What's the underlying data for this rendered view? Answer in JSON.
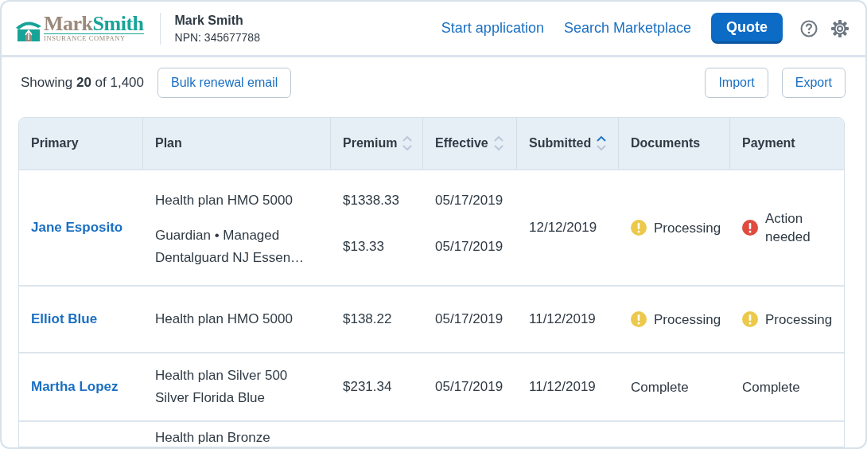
{
  "header": {
    "logo": {
      "first": "Mark",
      "second": "Smith",
      "tagline": "INSURANCE COMPANY"
    },
    "agent_name": "Mark Smith",
    "agent_npn": "NPN: 345677788",
    "links": [
      "Start application",
      "Search Marketplace"
    ],
    "primary_button": "Quote"
  },
  "toolbar": {
    "showing": "Showing **20** of 1,400",
    "bulk_button": "Bulk renewal email",
    "buttons": [
      "Import",
      "Export"
    ]
  },
  "table": {
    "columns": [
      {
        "label": "Primary",
        "kind": "plain"
      },
      {
        "label": "Plan",
        "kind": "plain"
      },
      {
        "label": "Premium",
        "kind": "sortable"
      },
      {
        "label": "Effective",
        "kind": "sortable"
      },
      {
        "label": "Submitted",
        "kind": "sorted"
      },
      {
        "label": "Documents",
        "kind": "plain"
      },
      {
        "label": "Payment",
        "kind": "plain"
      }
    ],
    "rows": [
      {
        "primary": "Jane Esposito",
        "plans": [
          {
            "plan": "Health plan HMO 5000",
            "premium": "$1338.33",
            "effective": "05/17/2019"
          },
          {
            "plan": "Guardian • Managed\nDentalguard NJ Essen…",
            "premium": "$13.33",
            "effective": "05/17/2019"
          }
        ],
        "submitted": "12/12/2019",
        "documents": {
          "text": "Processing",
          "kind": "warning"
        },
        "payment": {
          "text": "Action\nneeded",
          "kind": "error"
        }
      },
      {
        "primary": "Elliot Blue",
        "plans": [
          {
            "plan": "Health plan HMO 5000",
            "premium": "$138.22",
            "effective": "05/17/2019"
          }
        ],
        "submitted": "11/12/2019",
        "documents": {
          "text": "Processing",
          "kind": "warning"
        },
        "payment": {
          "text": "Processing",
          "kind": "warning"
        }
      },
      {
        "primary": "Martha Lopez",
        "plans": [
          {
            "plan": "Health plan Silver 500\nSilver Florida Blue",
            "premium": "$231.34",
            "effective": "05/17/2019"
          }
        ],
        "submitted": "11/12/2019",
        "documents": {
          "text": "Complete",
          "kind": "plain"
        },
        "payment": {
          "text": "Complete",
          "kind": "plain"
        }
      },
      {
        "plans": [
          {
            "plan": "Health plan Bronze"
          }
        ]
      }
    ]
  }
}
